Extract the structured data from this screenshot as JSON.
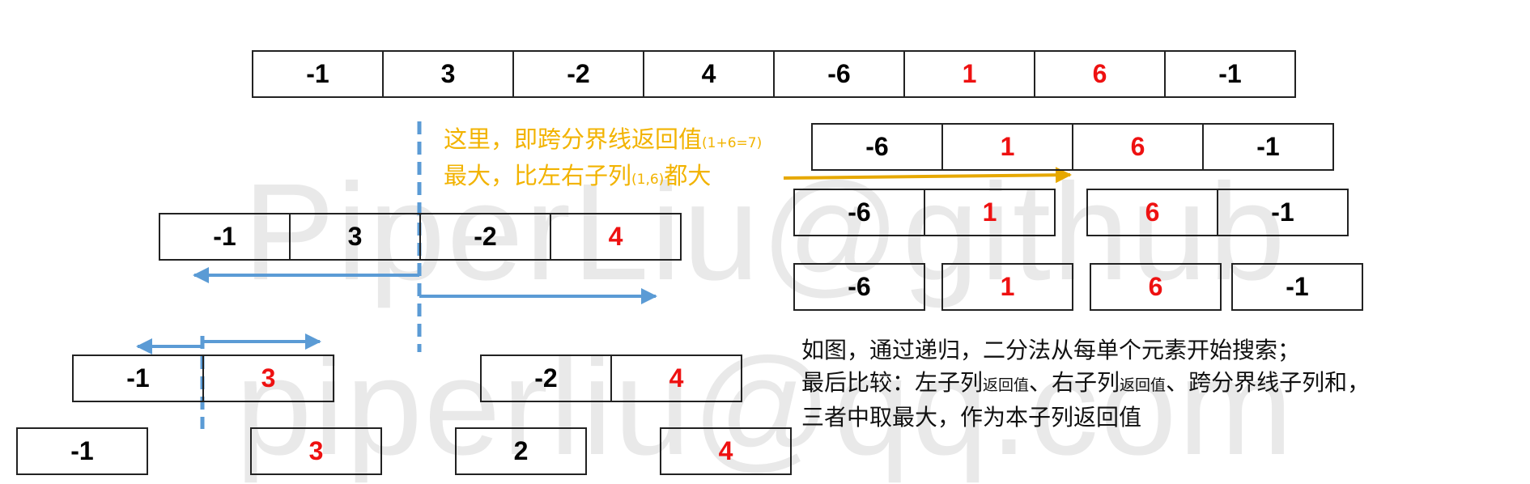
{
  "watermark": {
    "line1": "PiperLiu@github",
    "line2": "piperliu@qq.com"
  },
  "top_array": [
    {
      "value": "-1",
      "highlight": false
    },
    {
      "value": "3",
      "highlight": false
    },
    {
      "value": "-2",
      "highlight": false
    },
    {
      "value": "4",
      "highlight": false
    },
    {
      "value": "-6",
      "highlight": false
    },
    {
      "value": "1",
      "highlight": true
    },
    {
      "value": "6",
      "highlight": true
    },
    {
      "value": "-1",
      "highlight": false
    }
  ],
  "left_half": {
    "level1": [
      {
        "value": "-1",
        "highlight": false
      },
      {
        "value": "3",
        "highlight": false
      },
      {
        "value": "-2",
        "highlight": false
      },
      {
        "value": "4",
        "highlight": true
      }
    ],
    "level2_left": [
      {
        "value": "-1",
        "highlight": false
      },
      {
        "value": "3",
        "highlight": true
      }
    ],
    "level2_right": [
      {
        "value": "-2",
        "highlight": false
      },
      {
        "value": "4",
        "highlight": true
      }
    ],
    "level3": [
      {
        "value": "-1",
        "highlight": false
      },
      {
        "value": "3",
        "highlight": true
      },
      {
        "value": "2",
        "highlight": false
      },
      {
        "value": "4",
        "highlight": true
      }
    ]
  },
  "right_half": {
    "level1": [
      {
        "value": "-6",
        "highlight": false
      },
      {
        "value": "1",
        "highlight": true
      },
      {
        "value": "6",
        "highlight": true
      },
      {
        "value": "-1",
        "highlight": false
      }
    ],
    "level2_left": [
      {
        "value": "-6",
        "highlight": false
      },
      {
        "value": "1",
        "highlight": true
      }
    ],
    "level2_right": [
      {
        "value": "6",
        "highlight": true
      },
      {
        "value": "-1",
        "highlight": false
      }
    ],
    "level3": [
      {
        "value": "-6",
        "highlight": false
      },
      {
        "value": "1",
        "highlight": true
      },
      {
        "value": "6",
        "highlight": true
      },
      {
        "value": "-1",
        "highlight": false
      }
    ]
  },
  "annotation": {
    "line1_main": "这里，即跨分界线返回值",
    "line1_small": "(1+6=7)",
    "line2_a": "最大，比左右子列",
    "line2_small": "(1,6)",
    "line2_b": "都大"
  },
  "description": {
    "line1": "如图，通过递归，二分法从每单个元素开始搜索；",
    "line2_a": "最后比较：左子列",
    "line2_small1": "返回值",
    "line2_b": "、右子列",
    "line2_small2": "返回值",
    "line2_c": "、跨分界线子列和，",
    "line3": "三者中取最大，作为本子列返回值"
  },
  "colors": {
    "highlight_text": "#ee1111",
    "annotation_text": "#f2b300",
    "divider_and_arrows": "#5b9bd5",
    "pointer_arrow": "#e6a800",
    "watermark": "#e9e9e9",
    "cell_border": "#222222"
  }
}
